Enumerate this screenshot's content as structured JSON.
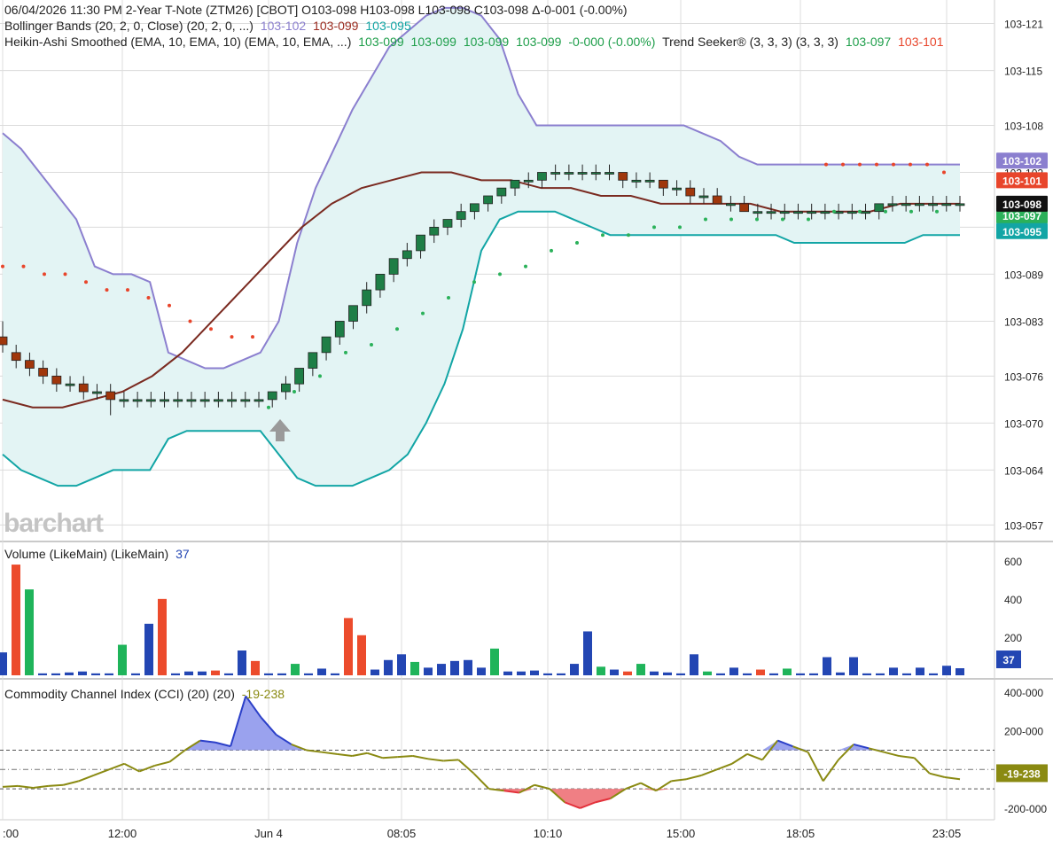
{
  "header": {
    "line1": "06/04/2026  11:30 PM  2-Year T-Note (ZTM26) [CBOT]  O103-098  H103-098  L103-098  C103-098  Δ-0-001  (-0.00%)",
    "bb_label": "Bollinger Bands (20, 2, 0, Close)  (20, 2, 0, ...)",
    "bb_values": [
      "103-102",
      "103-099",
      "103-095"
    ],
    "ha_label": "Heikin-Ashi Smoothed (EMA, 10, EMA, 10)  (EMA, 10, EMA, ...)",
    "ha_values": [
      "103-099",
      "103-099",
      "103-099",
      "103-099",
      "-0-000 (-0.00%)"
    ],
    "ts_label": "Trend Seeker® (3, 3, 3)  (3, 3, 3)",
    "ts_values": [
      "103-097",
      "103-101"
    ]
  },
  "watermark": "barchart",
  "colors": {
    "up": "#1e7e46",
    "down": "#a0360b",
    "bb_upper": "#8b7fcf",
    "bb_lower": "#12a5a5",
    "bb_fill": "#e3f4f4",
    "bb_mid": "#7a2a20",
    "ts_red": "#e8452b",
    "ts_green": "#2bb15a",
    "vol_blue": "#2346b3",
    "vol_red": "#ec4b2c",
    "vol_green": "#1fb45a",
    "cci_line": "#8a8a12",
    "cci_pos": "#2b3fc8",
    "cci_neg": "#e3303a",
    "grid": "#dcdcdc",
    "text": "#222222"
  },
  "price_axis": {
    "ticks": [
      "103-121",
      "103-115",
      "103-108",
      "103-102",
      "103-095",
      "103-089",
      "103-083",
      "103-076",
      "103-070",
      "103-064",
      "103-057"
    ],
    "tick_values": [
      103.121,
      103.115,
      103.108,
      103.102,
      103.095,
      103.089,
      103.083,
      103.076,
      103.07,
      103.064,
      103.057
    ]
  },
  "price_badges": [
    {
      "text": "103-102",
      "value": 103.1035,
      "color": "#8b7fcf"
    },
    {
      "text": "103-101",
      "value": 103.101,
      "color": "#e8452b"
    },
    {
      "text": "103-097",
      "value": 103.0965,
      "color": "#2bb15a"
    },
    {
      "text": "103-098",
      "value": 103.098,
      "color": "#111111"
    },
    {
      "text": "103-095",
      "value": 103.0945,
      "color": "#12a5a5"
    }
  ],
  "volume_panel": {
    "label": "Volume (LikeMain)  (LikeMain)",
    "value": "37",
    "ticks": [
      "600",
      "400",
      "200"
    ],
    "tick_values": [
      600,
      400,
      200
    ],
    "badge": "37"
  },
  "cci_panel": {
    "label": "Commodity Channel Index (CCI) (20)  (20)",
    "value": "-19-238",
    "ticks": [
      "400-000",
      "200-000",
      "-200-000"
    ],
    "tick_values": [
      400,
      200,
      -200
    ],
    "badge": "-19-238"
  },
  "time_axis": {
    "labels": [
      ":00",
      "12:00",
      "Jun 4",
      "08:05",
      "10:10",
      "15:00",
      "18:05",
      "23:05"
    ]
  },
  "chart_data": {
    "type": "candlestick",
    "title": "2-Year T-Note (ZTM26) [CBOT]",
    "ylim": [
      103.055,
      103.124
    ],
    "x_index_range": [
      0,
      71
    ],
    "candles": [
      [
        103.081,
        103.083,
        103.079,
        103.08
      ],
      [
        103.079,
        103.08,
        103.077,
        103.078
      ],
      [
        103.078,
        103.079,
        103.076,
        103.077
      ],
      [
        103.077,
        103.078,
        103.075,
        103.076
      ],
      [
        103.076,
        103.077,
        103.074,
        103.075
      ],
      [
        103.075,
        103.076,
        103.074,
        103.075
      ],
      [
        103.075,
        103.076,
        103.073,
        103.074
      ],
      [
        103.074,
        103.075,
        103.073,
        103.074
      ],
      [
        103.074,
        103.075,
        103.071,
        103.073
      ],
      [
        103.073,
        103.074,
        103.072,
        103.073
      ],
      [
        103.073,
        103.074,
        103.072,
        103.073
      ],
      [
        103.073,
        103.074,
        103.072,
        103.073
      ],
      [
        103.073,
        103.074,
        103.072,
        103.073
      ],
      [
        103.073,
        103.074,
        103.072,
        103.073
      ],
      [
        103.073,
        103.074,
        103.072,
        103.073
      ],
      [
        103.073,
        103.074,
        103.072,
        103.073
      ],
      [
        103.073,
        103.074,
        103.072,
        103.073
      ],
      [
        103.073,
        103.074,
        103.072,
        103.073
      ],
      [
        103.073,
        103.074,
        103.072,
        103.073
      ],
      [
        103.073,
        103.074,
        103.072,
        103.073
      ],
      [
        103.073,
        103.074,
        103.072,
        103.074
      ],
      [
        103.074,
        103.076,
        103.073,
        103.075
      ],
      [
        103.075,
        103.077,
        103.074,
        103.077
      ],
      [
        103.077,
        103.079,
        103.076,
        103.079
      ],
      [
        103.079,
        103.081,
        103.078,
        103.081
      ],
      [
        103.081,
        103.083,
        103.08,
        103.083
      ],
      [
        103.083,
        103.085,
        103.082,
        103.085
      ],
      [
        103.085,
        103.088,
        103.084,
        103.087
      ],
      [
        103.087,
        103.089,
        103.086,
        103.089
      ],
      [
        103.089,
        103.091,
        103.088,
        103.091
      ],
      [
        103.091,
        103.093,
        103.09,
        103.092
      ],
      [
        103.092,
        103.094,
        103.091,
        103.094
      ],
      [
        103.094,
        103.096,
        103.093,
        103.095
      ],
      [
        103.095,
        103.096,
        103.094,
        103.096
      ],
      [
        103.096,
        103.098,
        103.095,
        103.097
      ],
      [
        103.097,
        103.098,
        103.096,
        103.098
      ],
      [
        103.098,
        103.099,
        103.097,
        103.099
      ],
      [
        103.099,
        103.1,
        103.098,
        103.1
      ],
      [
        103.1,
        103.101,
        103.099,
        103.101
      ],
      [
        103.101,
        103.102,
        103.1,
        103.101
      ],
      [
        103.101,
        103.102,
        103.1,
        103.102
      ],
      [
        103.102,
        103.103,
        103.101,
        103.102
      ],
      [
        103.102,
        103.103,
        103.101,
        103.102
      ],
      [
        103.102,
        103.103,
        103.101,
        103.102
      ],
      [
        103.102,
        103.103,
        103.101,
        103.102
      ],
      [
        103.102,
        103.103,
        103.101,
        103.102
      ],
      [
        103.102,
        103.102,
        103.1,
        103.101
      ],
      [
        103.101,
        103.102,
        103.1,
        103.101
      ],
      [
        103.101,
        103.102,
        103.1,
        103.101
      ],
      [
        103.101,
        103.101,
        103.099,
        103.1
      ],
      [
        103.1,
        103.101,
        103.099,
        103.1
      ],
      [
        103.1,
        103.101,
        103.098,
        103.099
      ],
      [
        103.099,
        103.1,
        103.098,
        103.099
      ],
      [
        103.099,
        103.1,
        103.098,
        103.098
      ],
      [
        103.098,
        103.099,
        103.097,
        103.098
      ],
      [
        103.098,
        103.099,
        103.097,
        103.097
      ],
      [
        103.097,
        103.098,
        103.096,
        103.097
      ],
      [
        103.097,
        103.098,
        103.096,
        103.097
      ],
      [
        103.097,
        103.098,
        103.096,
        103.097
      ],
      [
        103.097,
        103.098,
        103.096,
        103.097
      ],
      [
        103.097,
        103.098,
        103.096,
        103.097
      ],
      [
        103.097,
        103.098,
        103.096,
        103.097
      ],
      [
        103.097,
        103.098,
        103.096,
        103.097
      ],
      [
        103.097,
        103.098,
        103.096,
        103.097
      ],
      [
        103.097,
        103.098,
        103.096,
        103.097
      ],
      [
        103.097,
        103.098,
        103.096,
        103.098
      ],
      [
        103.098,
        103.099,
        103.097,
        103.098
      ],
      [
        103.098,
        103.099,
        103.097,
        103.098
      ],
      [
        103.098,
        103.099,
        103.097,
        103.098
      ],
      [
        103.098,
        103.099,
        103.097,
        103.098
      ],
      [
        103.098,
        103.099,
        103.097,
        103.098
      ],
      [
        103.098,
        103.099,
        103.097,
        103.098
      ]
    ],
    "bb_upper": [
      103.107,
      103.105,
      103.102,
      103.099,
      103.096,
      103.09,
      103.089,
      103.089,
      103.088,
      103.079,
      103.078,
      103.077,
      103.077,
      103.078,
      103.079,
      103.083,
      103.093,
      103.1,
      103.105,
      103.11,
      103.114,
      103.118,
      103.12,
      103.122,
      103.123,
      103.123,
      103.122,
      103.119,
      103.112,
      103.108,
      103.108,
      103.108,
      103.108,
      103.108,
      103.108,
      103.108,
      103.108,
      103.108,
      103.107,
      103.106,
      103.104,
      103.103,
      103.103,
      103.103,
      103.103,
      103.103,
      103.103,
      103.103,
      103.103,
      103.103,
      103.103,
      103.103,
      103.103
    ],
    "bb_lower": [
      103.066,
      103.064,
      103.063,
      103.062,
      103.062,
      103.063,
      103.064,
      103.064,
      103.064,
      103.068,
      103.069,
      103.069,
      103.069,
      103.069,
      103.069,
      103.066,
      103.063,
      103.062,
      103.062,
      103.062,
      103.063,
      103.064,
      103.066,
      103.07,
      103.075,
      103.082,
      103.092,
      103.096,
      103.097,
      103.097,
      103.097,
      103.096,
      103.095,
      103.094,
      103.094,
      103.094,
      103.094,
      103.094,
      103.094,
      103.094,
      103.094,
      103.094,
      103.094,
      103.093,
      103.093,
      103.093,
      103.093,
      103.093,
      103.093,
      103.093,
      103.094,
      103.094,
      103.094
    ],
    "bb_middle": [
      103.073,
      103.072,
      103.072,
      103.073,
      103.074,
      103.076,
      103.079,
      103.083,
      103.087,
      103.091,
      103.095,
      103.098,
      103.1,
      103.101,
      103.102,
      103.102,
      103.101,
      103.101,
      103.1,
      103.1,
      103.099,
      103.099,
      103.098,
      103.098,
      103.098,
      103.098,
      103.097,
      103.097,
      103.097,
      103.097,
      103.098,
      103.098,
      103.098
    ],
    "volume": [
      120,
      580,
      450,
      10,
      10,
      15,
      20,
      10,
      10,
      160,
      10,
      270,
      400,
      10,
      20,
      20,
      25,
      10,
      130,
      75,
      10,
      10,
      60,
      10,
      35,
      10,
      300,
      210,
      30,
      80,
      110,
      70,
      40,
      60,
      75,
      80,
      40,
      140,
      20,
      20,
      25,
      10,
      10,
      60,
      230,
      45,
      30,
      20,
      60,
      20,
      15,
      10,
      110,
      20,
      10,
      40,
      10,
      30,
      10,
      35,
      10,
      10,
      95,
      15,
      95,
      10,
      10,
      40,
      10,
      40,
      10,
      50,
      37
    ],
    "volume_color": [
      "b",
      "r",
      "g",
      "b",
      "b",
      "b",
      "b",
      "b",
      "b",
      "g",
      "b",
      "b",
      "r",
      "b",
      "b",
      "b",
      "r",
      "b",
      "b",
      "r",
      "b",
      "b",
      "g",
      "b",
      "b",
      "b",
      "r",
      "r",
      "b",
      "b",
      "b",
      "g",
      "b",
      "b",
      "b",
      "b",
      "b",
      "g",
      "b",
      "b",
      "b",
      "b",
      "b",
      "b",
      "b",
      "g",
      "b",
      "r",
      "g",
      "b",
      "b",
      "b",
      "b",
      "g",
      "b",
      "b",
      "b",
      "r",
      "b",
      "g",
      "b",
      "b",
      "b",
      "b",
      "b",
      "b",
      "b",
      "b",
      "b",
      "b",
      "b",
      "b",
      "b"
    ],
    "cci": [
      -90,
      -85,
      -95,
      -85,
      -80,
      -60,
      -30,
      0,
      30,
      -10,
      20,
      40,
      100,
      150,
      140,
      120,
      380,
      270,
      180,
      130,
      100,
      90,
      80,
      70,
      85,
      60,
      65,
      70,
      55,
      45,
      50,
      -20,
      -100,
      -110,
      -120,
      -80,
      -100,
      -170,
      -200,
      -170,
      -150,
      -100,
      -70,
      -110,
      -60,
      -50,
      -30,
      0,
      30,
      80,
      50,
      150,
      120,
      90,
      -60,
      50,
      130,
      110,
      90,
      70,
      60,
      -20,
      -40,
      -50
    ],
    "trend_seeker_red": [
      103.09,
      103.09,
      103.089,
      103.089,
      103.088,
      103.087,
      103.087,
      103.086,
      103.085,
      103.083,
      103.082,
      103.081,
      103.081,
      103.103,
      103.103,
      103.103,
      103.103,
      103.103,
      103.103,
      103.103,
      103.102
    ],
    "trend_seeker_green": [
      103.072,
      103.074,
      103.076,
      103.079,
      103.08,
      103.082,
      103.084,
      103.086,
      103.088,
      103.089,
      103.09,
      103.092,
      103.093,
      103.094,
      103.094,
      103.095,
      103.095,
      103.096,
      103.096,
      103.096,
      103.096,
      103.096,
      103.097,
      103.097,
      103.097,
      103.097,
      103.097
    ]
  }
}
